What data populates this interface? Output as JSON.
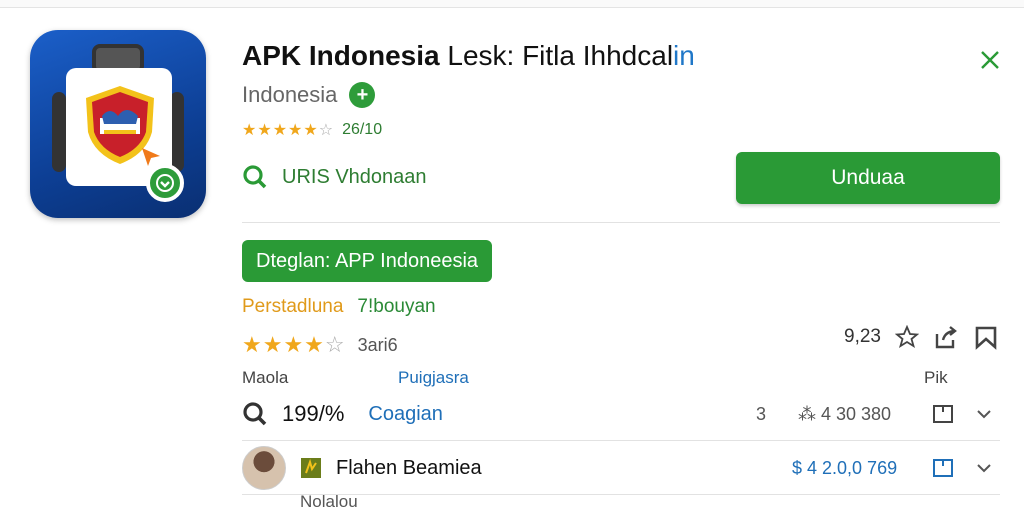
{
  "app": {
    "title_bold": "APK Indonesia",
    "title_rest": " Lesk: Fitla Ihhdcal",
    "title_accent": "in",
    "subtitle": "Indonesia",
    "plus_glyph": "+",
    "rating_text": "26/10",
    "stars_filled": "★★★★★",
    "stars_empty": "☆",
    "vendor": "URIS Vhdonaan",
    "install_label": "Unduaa"
  },
  "details": {
    "pill_label": "Dteglan: APP Indoneesia",
    "meta_a": "Perstadluna",
    "meta_b": "7!bouyan",
    "rating_stars": "★★★★",
    "rating_empty": "☆",
    "rating_count": "3ari6",
    "score": "9,23",
    "label_a": "Maola",
    "label_b": "Puigjasra",
    "label_c": "Pik"
  },
  "rows": [
    {
      "percent": "199/%",
      "link": "Coagian",
      "count": "3",
      "value": "⁂ 4 30 380"
    },
    {
      "name": "Flahen Beamiea",
      "value": "$ 4  2.0,0 769",
      "sub": "Nolalou"
    }
  ],
  "colors": {
    "accent": "#2a9a36",
    "link": "#1f6fb8",
    "star": "#f0a71c"
  }
}
